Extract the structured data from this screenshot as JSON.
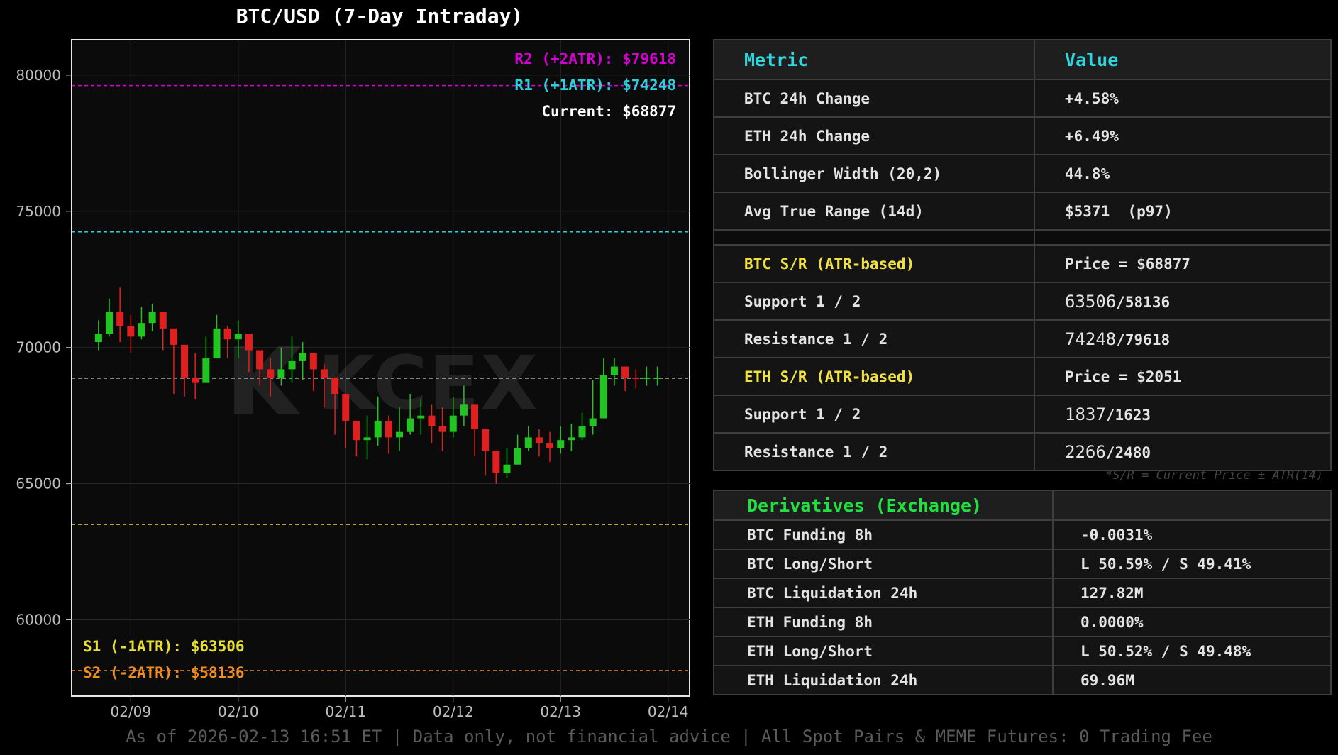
{
  "chart_data": {
    "type": "candlestick",
    "title": "BTC/USD (7-Day Intraday)",
    "x_ticks": [
      "02/09",
      "02/10",
      "02/11",
      "02/12",
      "02/13",
      "02/14"
    ],
    "x_range": [
      -0.55,
      5.2
    ],
    "y_ticks": [
      60000,
      65000,
      70000,
      75000,
      80000
    ],
    "ylim": [
      57200,
      81300
    ],
    "grid": true,
    "levels": [
      {
        "label": "R2 (+2ATR): $79618",
        "value": 79618,
        "color": "#d400d4",
        "label_pos": "top-right"
      },
      {
        "label": "R1 (+1ATR): $74248",
        "value": 74248,
        "color": "#2ad2dc",
        "label_pos": "top-right"
      },
      {
        "label": "Current: $68877",
        "value": 68877,
        "color": "#c8c8c8",
        "label_pos": "top-right"
      },
      {
        "label": "S1 (-1ATR): $63506",
        "value": 63506,
        "color": "#e8e030",
        "label_pos": "bottom-left"
      },
      {
        "label": "S2 (-2ATR): $58136",
        "value": 58136,
        "color": "#f08c20",
        "label_pos": "bottom-left"
      }
    ],
    "series": [
      {
        "x": [
          -0.3,
          -0.2,
          -0.1,
          0.0,
          0.1,
          0.2,
          0.3,
          0.4,
          0.5,
          0.6,
          0.7,
          0.8,
          0.9,
          1.0,
          1.1,
          1.2,
          1.3,
          1.4,
          1.5,
          1.6,
          1.7,
          1.8,
          1.9,
          2.0,
          2.1,
          2.2,
          2.3,
          2.4,
          2.5,
          2.6,
          2.7,
          2.8,
          2.9,
          3.0,
          3.1,
          3.2,
          3.3,
          3.4,
          3.5,
          3.6,
          3.7,
          3.8,
          3.9,
          4.0,
          4.1,
          4.2,
          4.3,
          4.4,
          4.5,
          4.6,
          4.7,
          4.8,
          4.9
        ],
        "close": [
          70500,
          71300,
          70800,
          70400,
          70900,
          71300,
          70700,
          70100,
          68900,
          68700,
          69600,
          70700,
          70300,
          70500,
          69900,
          69200,
          68900,
          69200,
          69500,
          69800,
          69200,
          68900,
          68300,
          67300,
          66600,
          66700,
          67300,
          66700,
          66900,
          67400,
          67500,
          67100,
          66900,
          67500,
          67900,
          67000,
          66200,
          65400,
          65700,
          66300,
          66700,
          66500,
          66300,
          66600,
          66700,
          67100,
          67400,
          69000,
          69300,
          68900,
          68877,
          68900,
          68900
        ],
        "high": [
          71000,
          71800,
          72200,
          71200,
          71500,
          71600,
          71200,
          70600,
          69600,
          69800,
          70400,
          71200,
          70800,
          71000,
          70400,
          69900,
          69600,
          70000,
          70400,
          70200,
          69800,
          69400,
          68900,
          68200,
          67300,
          67500,
          68200,
          67500,
          67800,
          68300,
          68100,
          67900,
          67800,
          68200,
          68600,
          67800,
          66900,
          66000,
          66300,
          66800,
          67100,
          67000,
          66900,
          67100,
          67200,
          67600,
          68800,
          69600,
          69600,
          69300,
          69200,
          69300,
          69300
        ],
        "low": [
          69900,
          70400,
          70200,
          69800,
          70300,
          70600,
          69900,
          68300,
          68200,
          68100,
          68800,
          69800,
          69600,
          69600,
          69100,
          68600,
          68200,
          68600,
          68700,
          68800,
          68400,
          67800,
          66800,
          66300,
          66000,
          65900,
          66400,
          66100,
          66200,
          66800,
          66800,
          66500,
          66200,
          66700,
          67100,
          66000,
          65300,
          65000,
          65200,
          65800,
          66200,
          66000,
          65800,
          66100,
          66200,
          66600,
          66800,
          68500,
          68600,
          68400,
          68500,
          68600,
          68600
        ]
      }
    ]
  },
  "metrics": {
    "headers": [
      "Metric",
      "Value"
    ],
    "rows": [
      {
        "label": "BTC 24h Change",
        "value": "+4.58%"
      },
      {
        "label": "ETH 24h Change",
        "value": "+6.49%"
      },
      {
        "label": "Bollinger Width (20,2)",
        "value": "44.8%"
      },
      {
        "label": "Avg True Range (14d)",
        "value": "$5371  (p97)"
      },
      {
        "label": "BTC S/R (ATR-based)",
        "value": "Price = $68877"
      },
      {
        "label": "Support 1 / 2",
        "value_a": "63506",
        "value_b": "/58136"
      },
      {
        "label": "Resistance 1 / 2",
        "value_a": "74248",
        "value_b": "/79618"
      },
      {
        "label": "ETH S/R (ATR-based)",
        "value": "Price = $2051"
      },
      {
        "label": "Support 1 / 2",
        "value_a": "1837",
        "value_b": "/1623"
      },
      {
        "label": "Resistance 1 / 2",
        "value_a": "2266",
        "value_b": "/2480"
      }
    ],
    "footnote": "*S/R = Current Price ± ATR(14)"
  },
  "derivatives": {
    "title": "Derivatives (Exchange)",
    "rows": [
      {
        "label": "BTC Funding 8h",
        "value": "-0.0031%"
      },
      {
        "label": "BTC Long/Short",
        "value": "L 50.59% / S 49.41%"
      },
      {
        "label": "BTC Liquidation 24h",
        "value": "127.82M"
      },
      {
        "label": "ETH Funding 8h",
        "value": "0.0000%"
      },
      {
        "label": "ETH Long/Short",
        "value": "L 50.52% / S 49.48%"
      },
      {
        "label": "ETH Liquidation 24h",
        "value": "69.96M"
      }
    ]
  },
  "watermark": "KCEX",
  "footer": "As of 2026-02-13 16:51 ET | Data only, not financial advice | All Spot Pairs & MEME Futures: 0 Trading Fee",
  "colors": {
    "up": "#22c422",
    "down": "#e02020",
    "cyan_header": "#2fd6e0",
    "section_yellow": "#f0e040",
    "derivatives_green": "#22e040"
  }
}
